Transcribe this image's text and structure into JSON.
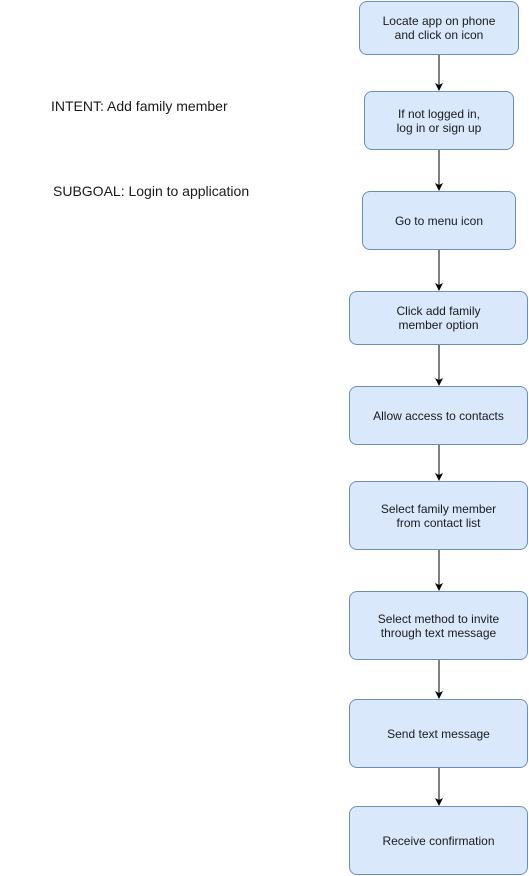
{
  "annotations": {
    "intent": "INTENT: Add family member",
    "subgoal": "SUBGOAL: Login to application"
  },
  "steps": [
    "Locate app on phone\nand click on icon",
    "If not logged in,\nlog in or sign up",
    "Go to menu icon",
    "Click add family\nmember option",
    "Allow access to contacts",
    "Select family member\nfrom contact list",
    "Select method to invite\nthrough text message",
    "Send text message",
    "Receive confirmation"
  ],
  "colors": {
    "box_fill": "#dae8fc",
    "box_border": "#6c8ebf",
    "arrow": "#000000"
  }
}
